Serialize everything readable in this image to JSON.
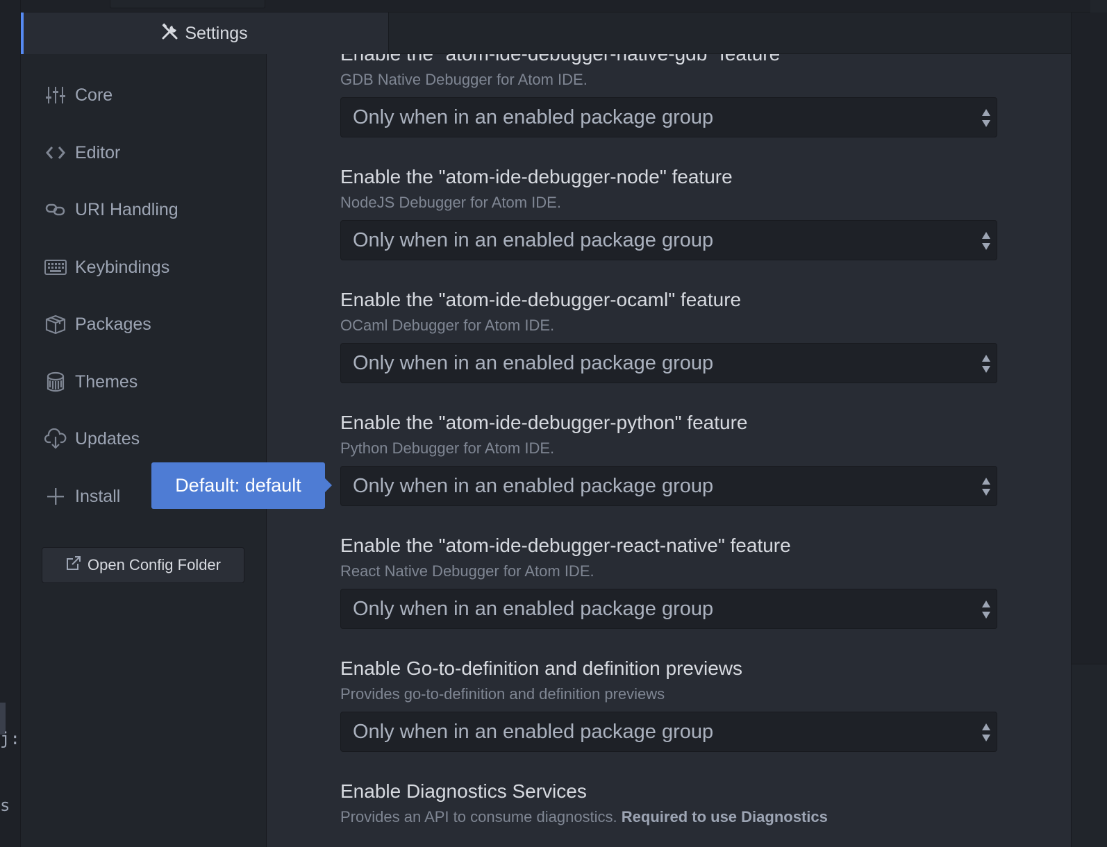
{
  "tab": {
    "title": "Settings",
    "icon": "tools-icon"
  },
  "sidebar": {
    "items": [
      {
        "label": "Core",
        "icon": "sliders-icon"
      },
      {
        "label": "Editor",
        "icon": "code-icon"
      },
      {
        "label": "URI Handling",
        "icon": "link-icon"
      },
      {
        "label": "Keybindings",
        "icon": "keyboard-icon"
      },
      {
        "label": "Packages",
        "icon": "package-icon"
      },
      {
        "label": "Themes",
        "icon": "paintcan-icon"
      },
      {
        "label": "Updates",
        "icon": "cloud-download-icon"
      },
      {
        "label": "Install",
        "icon": "plus-icon"
      }
    ],
    "config_button": "Open Config Folder"
  },
  "tooltip": {
    "text": "Default: default"
  },
  "settings": [
    {
      "title": "Enable the \"atom-ide-debugger-native-gdb\" feature",
      "description": "GDB Native Debugger for Atom IDE.",
      "value": "Only when in an enabled package group"
    },
    {
      "title": "Enable the \"atom-ide-debugger-node\" feature",
      "description": "NodeJS Debugger for Atom IDE.",
      "value": "Only when in an enabled package group"
    },
    {
      "title": "Enable the \"atom-ide-debugger-ocaml\" feature",
      "description": "OCaml Debugger for Atom IDE.",
      "value": "Only when in an enabled package group"
    },
    {
      "title": "Enable the \"atom-ide-debugger-python\" feature",
      "description": "Python Debugger for Atom IDE.",
      "value": "Only when in an enabled package group"
    },
    {
      "title": "Enable the \"atom-ide-debugger-react-native\" feature",
      "description": "React Native Debugger for Atom IDE.",
      "value": "Only when in an enabled package group"
    },
    {
      "title": "Enable Go-to-definition and definition previews",
      "description": "Provides go-to-definition and definition previews",
      "value": "Only when in an enabled package group"
    },
    {
      "title": "Enable Diagnostics Services",
      "description": "Provides an API to consume diagnostics.",
      "description_bold": "Required to use Diagnostics"
    }
  ],
  "left_strip": {
    "glyphs": [
      "j:",
      "s"
    ]
  },
  "colors": {
    "accent": "#568af2",
    "tooltip": "#4e7cd4"
  }
}
